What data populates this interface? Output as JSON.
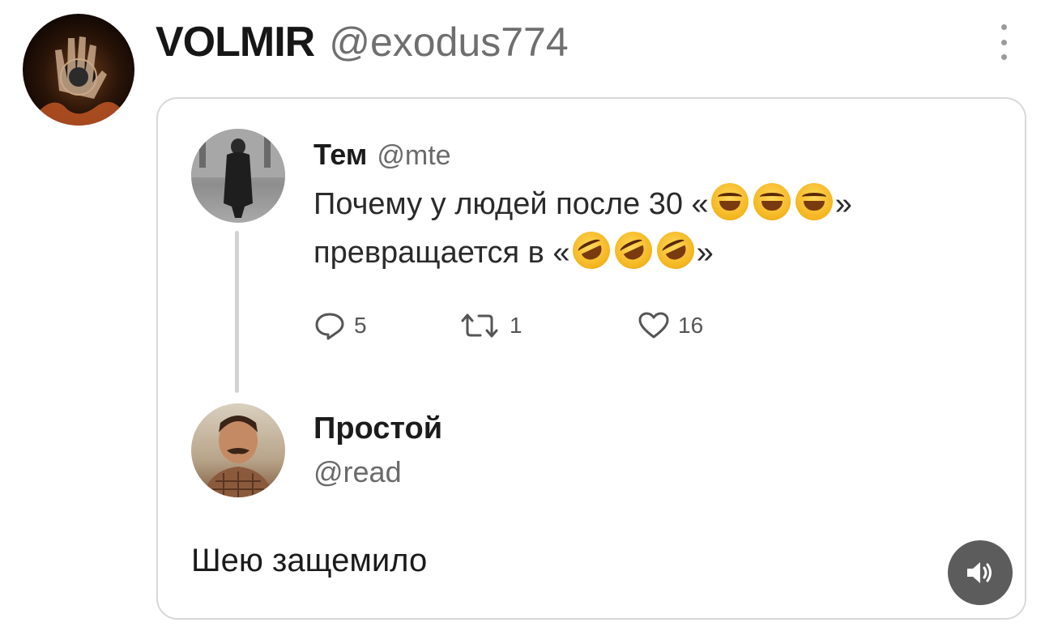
{
  "post": {
    "display_name": "VOLMIR",
    "handle": "@exodus774",
    "avatar_icon": "hand-fire-avatar",
    "menu_icon": "more-vertical-icon"
  },
  "quoted": {
    "author": {
      "name": "Тем",
      "handle": "@mte",
      "avatar_icon": "person-in-coat-avatar"
    },
    "text_line1": "Почему у людей после 30 «",
    "text_line1_end": "»",
    "text_line2": "превращается в «",
    "text_line2_end": "»",
    "emoji_line1": [
      "face-with-tears-of-joy",
      "face-with-tears-of-joy",
      "face-with-tears-of-joy"
    ],
    "emoji_line2": [
      "rolling-on-floor-laughing",
      "rolling-on-floor-laughing",
      "rolling-on-floor-laughing"
    ],
    "stats": {
      "replies": "5",
      "retweets": "1",
      "likes": "16"
    }
  },
  "reply": {
    "author": {
      "name": "Простой",
      "handle": "@read",
      "avatar_icon": "mustache-man-avatar"
    },
    "text": "Шею защемило"
  },
  "sound_button_icon": "speaker-icon",
  "colors": {
    "card_border": "#d8d8d8",
    "thread_line": "#d2d2d2",
    "handle_gray": "#6f6f6f",
    "sound_button": "#5c5c5c"
  }
}
